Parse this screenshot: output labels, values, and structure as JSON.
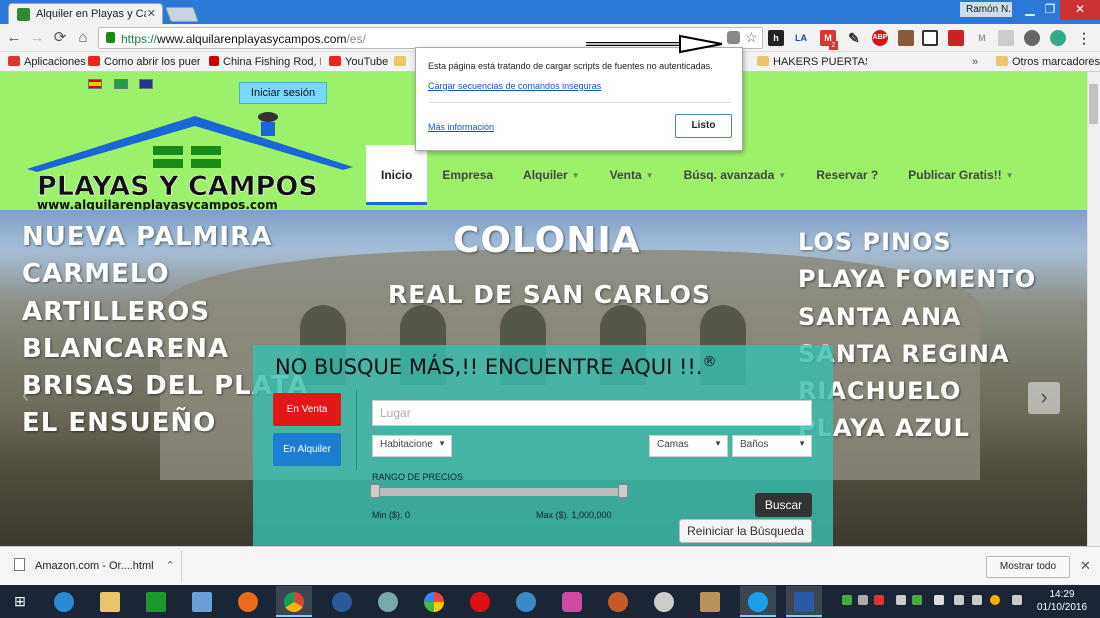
{
  "browser": {
    "tab_title": "Alquiler en Playas y Cam",
    "user_name": "Ramón N.",
    "url_scheme": "https://",
    "url_host": "www.alquilarenplayasycampos.com",
    "url_path": "/es/",
    "ext_la": "LA",
    "ext_abp": "ABP",
    "ext_gmail_count": "2"
  },
  "bookmarks": [
    {
      "label": "Aplicaciones"
    },
    {
      "label": "Como abrir los puertc"
    },
    {
      "label": "China Fishing Rod, Fis"
    },
    {
      "label": "YouTube"
    },
    {
      "label": "HAKERS PUERTAS TR"
    },
    {
      "label": "Otros marcadores"
    }
  ],
  "security_popup": {
    "message": "Esta página está tratando de cargar scripts de fuentes no autenticadas.",
    "load_link": "Cargar secuencias de comandos inseguras",
    "more_info": "Más información",
    "done_button": "Listo"
  },
  "site": {
    "login_button": "Iniciar sesión",
    "logo_title": "PLAYAS Y CAMPOS",
    "logo_url": "www.alquilarenplayasycampos.com",
    "nav": [
      "Inicio",
      "Empresa",
      "Alquiler",
      "Venta",
      "Búsq. avanzada",
      "Reservar ?",
      "Publicar Gratis!!"
    ]
  },
  "hero": {
    "left_places": [
      "NUEVA PALMIRA",
      "CARMELO",
      "ARTILLEROS",
      "BLANCARENA",
      "BRISAS DEL PLATA",
      "EL ENSUEÑO"
    ],
    "center_title": "COLONIA",
    "center_subtitle": "REAL DE SAN CARLOS",
    "right_places": [
      "LOS PINOS",
      "PLAYA FOMENTO",
      "SANTA ANA",
      "SANTA REGINA",
      "RIACHUELO",
      "PLAYA AZUL"
    ]
  },
  "search": {
    "title": "NO BUSQUE MÁS,!! ENCUENTRE AQUI !!.",
    "registered": "®",
    "btn_venta": "En Venta",
    "btn_alquiler": "En Alquiler",
    "lugar_placeholder": "Lugar",
    "habitaciones": "Habitacione",
    "camas": "Camas",
    "banos": "Baños",
    "price_range_label": "RANGO DE PRECIOS",
    "min_label": "Min ($). 0",
    "max_label": "Max ($). 1,000,000",
    "buscar_button": "Buscar",
    "reset_button": "Reiniciar la Búsqueda"
  },
  "downloads": {
    "item": "Amazon.com - Or....html",
    "show_all": "Mostrar todo"
  },
  "taskbar": {
    "time": "14:29",
    "date": "01/10/2016"
  }
}
